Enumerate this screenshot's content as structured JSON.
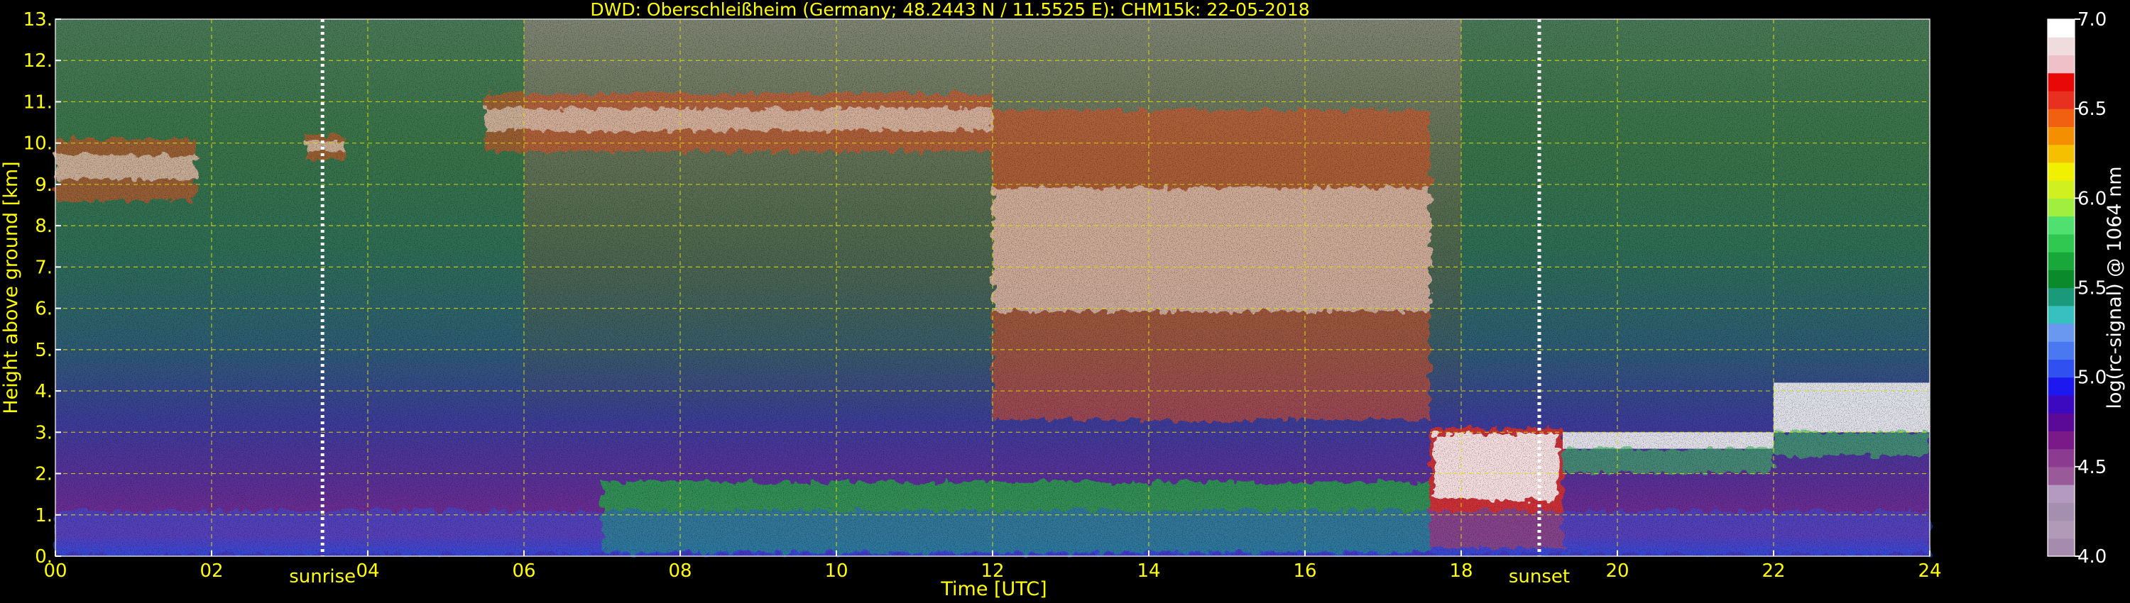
{
  "chart_data": {
    "type": "heatmap",
    "title": "DWD: Oberschleißheim (Germany; 48.2443 N / 11.5525 E):    CHM15k: 22-05-2018",
    "xlabel": "Time [UTC]",
    "ylabel": "Height above ground [km]",
    "xlim": [
      0,
      24
    ],
    "ylim": [
      0,
      13
    ],
    "x_ticks": [
      "00",
      "02",
      "04",
      "06",
      "08",
      "10",
      "12",
      "14",
      "16",
      "18",
      "20",
      "22",
      "24"
    ],
    "y_ticks": [
      "0.",
      "1.",
      "2.",
      "3.",
      "4.",
      "5.",
      "6.",
      "7.",
      "8.",
      "9.",
      "10.",
      "11.",
      "12.",
      "13."
    ],
    "grid": true,
    "markers": [
      {
        "label": "sunrise",
        "time": 3.42
      },
      {
        "label": "sunset",
        "time": 19.0
      }
    ],
    "colorbar": {
      "label": "log(rc-signal) @ 1064 nm",
      "range": [
        4.0,
        7.0
      ],
      "ticks": [
        "4.0",
        "4.5",
        "5.0",
        "5.5",
        "6.0",
        "6.5",
        "7.0"
      ],
      "colors": [
        "#a58cae",
        "#b19ab8",
        "#a58fb0",
        "#b49ac0",
        "#9a5a9a",
        "#8c3c90",
        "#7a1a88",
        "#5a0a96",
        "#3c08c0",
        "#1d17f0",
        "#3050f0",
        "#4a78f0",
        "#6a98f0",
        "#38c0c0",
        "#1a9a7a",
        "#0a8a2a",
        "#18a83a",
        "#30c850",
        "#50e070",
        "#a0ee40",
        "#d0f020",
        "#f0f000",
        "#f4c000",
        "#f49000",
        "#f06010",
        "#e83020",
        "#e80808",
        "#f0c0c8",
        "#f0dcdc",
        "#ffffff"
      ]
    },
    "features": [
      {
        "kind": "cirrus",
        "start": 0.0,
        "end": 1.8,
        "base_km": 8.6,
        "top_km": 10.1
      },
      {
        "kind": "cirrus",
        "start": 3.2,
        "end": 3.7,
        "base_km": 9.6,
        "top_km": 10.2
      },
      {
        "kind": "cirrus",
        "start": 5.5,
        "end": 12.0,
        "base_km": 9.8,
        "top_km": 11.2
      },
      {
        "kind": "cirrus",
        "start": 12.0,
        "end": 17.6,
        "base_km": 3.3,
        "top_km": 10.8
      },
      {
        "kind": "low_cloud",
        "start": 17.6,
        "end": 19.3,
        "base_km": 0.2,
        "top_km": 3.1
      },
      {
        "kind": "mid_cloud",
        "start": 19.3,
        "end": 22.0,
        "base_km": 2.6,
        "top_km": 3.0
      },
      {
        "kind": "mid_cloud",
        "start": 22.0,
        "end": 24.0,
        "base_km": 3.0,
        "top_km": 4.2
      },
      {
        "kind": "boundary_layer",
        "start": 7.0,
        "end": 17.6,
        "base_km": 0.1,
        "top_km": 1.8
      }
    ]
  }
}
